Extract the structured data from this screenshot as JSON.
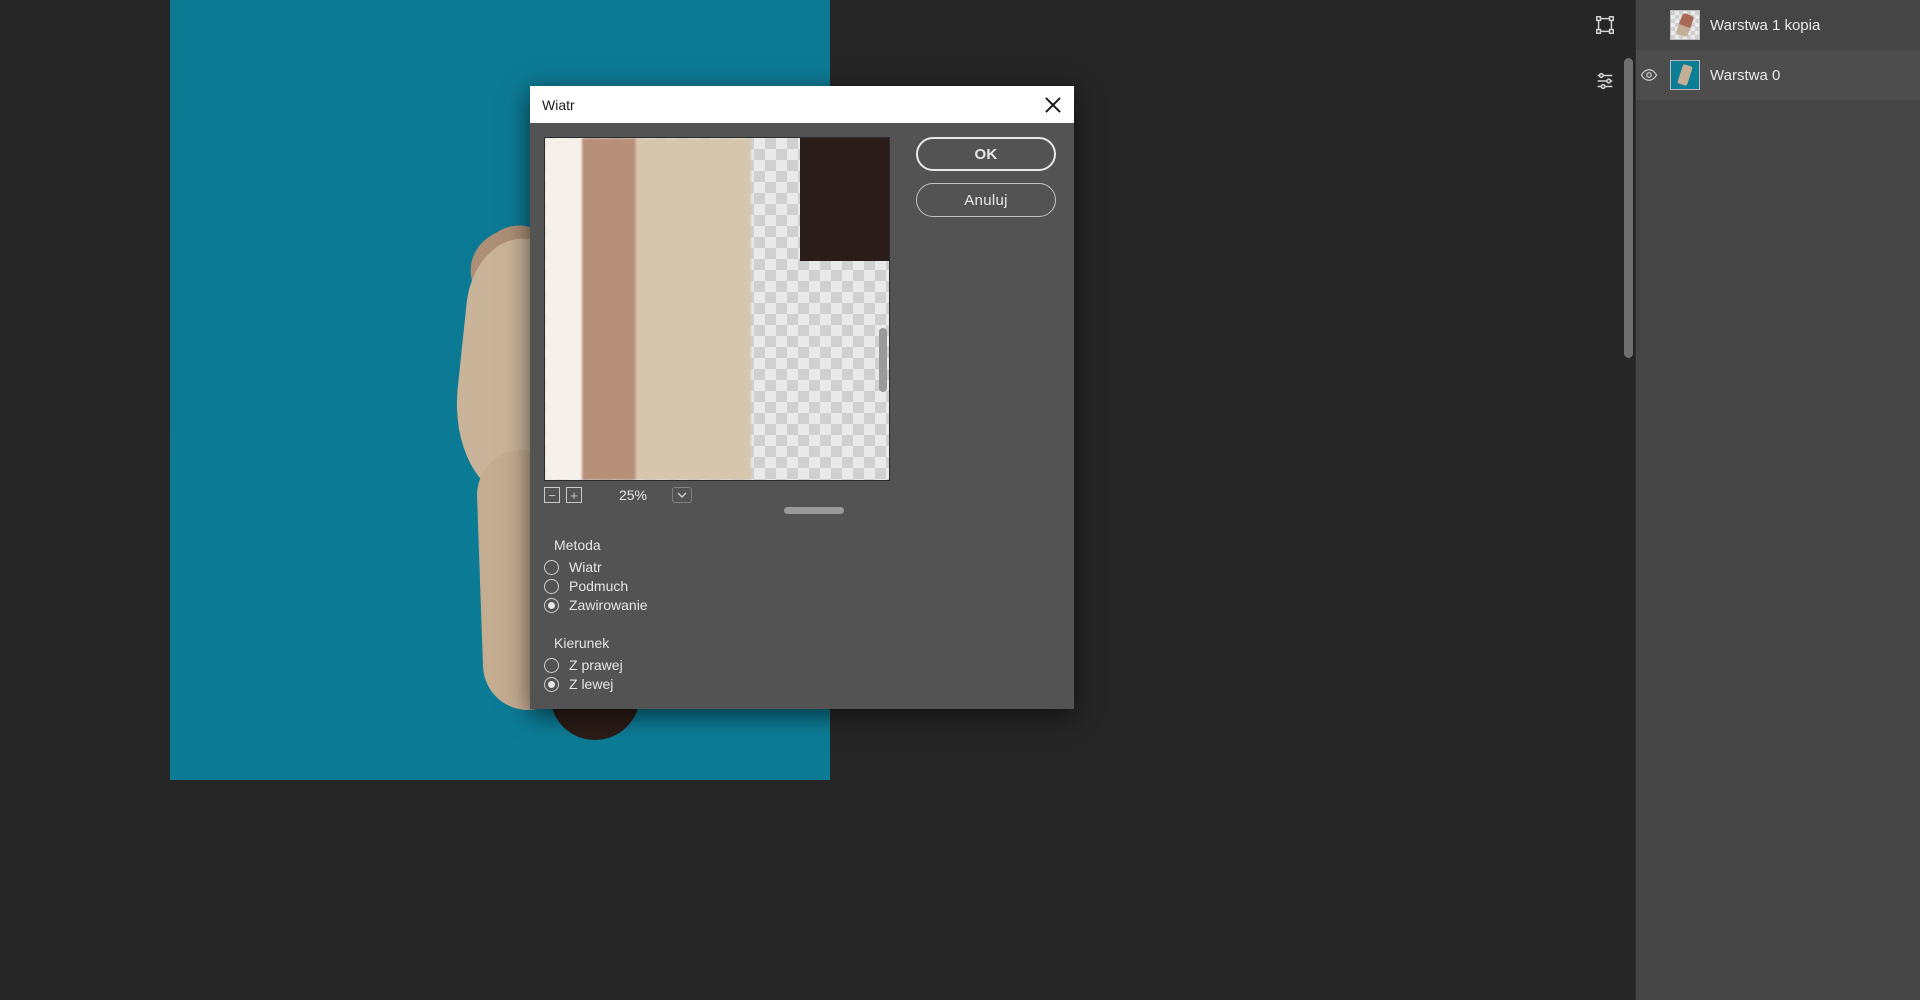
{
  "dialog": {
    "title": "Wiatr",
    "ok": "OK",
    "cancel": "Anuluj",
    "zoom": "25%",
    "method": {
      "label": "Metoda",
      "options": [
        "Wiatr",
        "Podmuch",
        "Zawirowanie"
      ],
      "selected": 2
    },
    "direction": {
      "label": "Kierunek",
      "options": [
        "Z prawej",
        "Z lewej"
      ],
      "selected": 1
    }
  },
  "layers": [
    {
      "name": "Warstwa 1 kopia",
      "visible": false,
      "thumb": "checker"
    },
    {
      "name": "Warstwa 0",
      "visible": true,
      "thumb": "teal"
    }
  ]
}
